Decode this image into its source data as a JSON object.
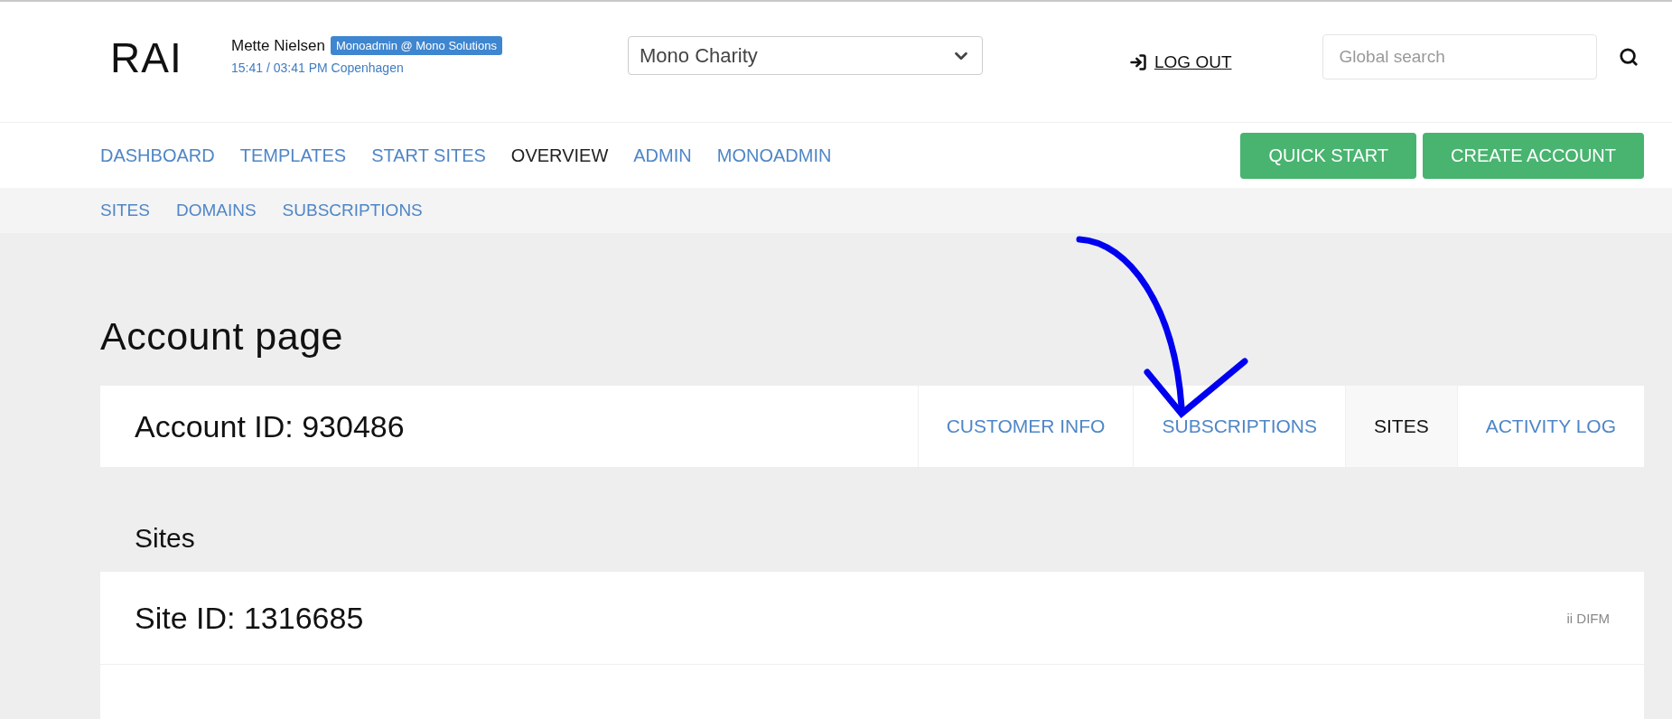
{
  "header": {
    "logo": "RAI",
    "user_name": "Mette Nielsen",
    "role_badge": "Monoadmin @ Mono Solutions",
    "time": "15:41 / 03:41 PM Copenhagen",
    "account_select": "Mono Charity",
    "logout": "LOG OUT",
    "search": {
      "placeholder": "Global search"
    }
  },
  "nav": [
    {
      "label": "DASHBOARD",
      "selected": false
    },
    {
      "label": "TEMPLATES",
      "selected": false
    },
    {
      "label": "START SITES",
      "selected": false
    },
    {
      "label": "OVERVIEW",
      "selected": true
    },
    {
      "label": "ADMIN",
      "selected": false
    },
    {
      "label": "MONOADMIN",
      "selected": false
    }
  ],
  "actions": [
    "QUICK START",
    "CREATE ACCOUNT"
  ],
  "subnav": [
    {
      "label": "SITES",
      "selected": false
    },
    {
      "label": "DOMAINS",
      "selected": false
    },
    {
      "label": "SUBSCRIPTIONS",
      "selected": false
    }
  ],
  "page_title": "Account page",
  "account": {
    "title": "Account ID: 930486",
    "tabs": [
      {
        "label": "CUSTOMER INFO",
        "selected": false
      },
      {
        "label": "SUBSCRIPTIONS",
        "selected": false
      },
      {
        "label": "SITES",
        "selected": true
      },
      {
        "label": "ACTIVITY LOG",
        "selected": false
      }
    ]
  },
  "sites": {
    "heading": "Sites",
    "items": [
      {
        "title": "Site ID: 1316685",
        "tag": "ii DIFM"
      }
    ]
  }
}
